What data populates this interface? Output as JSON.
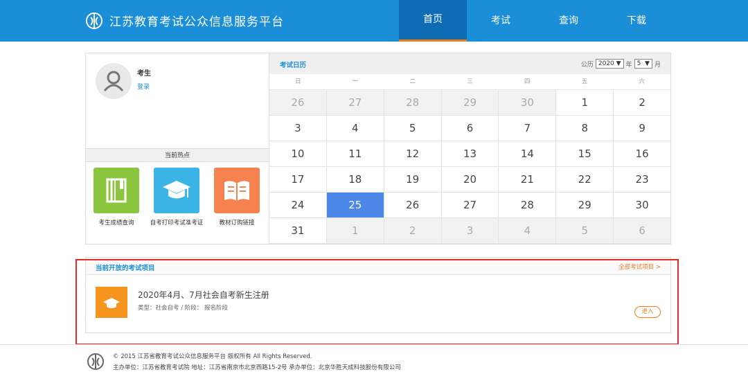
{
  "header": {
    "site_title": "江苏教育考试公众信息服务平台",
    "nav": [
      "首页",
      "考试",
      "查询",
      "下载"
    ],
    "active_nav": "首页"
  },
  "user": {
    "name": "考生",
    "login_label": "登录"
  },
  "hot": {
    "title": "当前热点",
    "items": [
      {
        "label": "考生成绩查询",
        "icon": "notebook-icon",
        "color": "#8cc63f"
      },
      {
        "label": "自考打印考试准考证",
        "icon": "graduation-cap-icon",
        "color": "#3bb4e6"
      },
      {
        "label": "教材订购链接",
        "icon": "open-book-icon",
        "color": "#f5824f"
      }
    ]
  },
  "calendar": {
    "title": "考试日历",
    "era_label": "公历",
    "year": "2020",
    "year_unit": "年",
    "month": "5",
    "month_unit": "月",
    "weekdays": [
      "日",
      "一",
      "二",
      "三",
      "四",
      "五",
      "六"
    ],
    "weeks": [
      [
        "26",
        "27",
        "28",
        "29",
        "30",
        "1",
        "2"
      ],
      [
        "3",
        "4",
        "5",
        "6",
        "7",
        "8",
        "9"
      ],
      [
        "10",
        "11",
        "12",
        "13",
        "14",
        "15",
        "16"
      ],
      [
        "17",
        "18",
        "19",
        "20",
        "21",
        "22",
        "23"
      ],
      [
        "24",
        "25",
        "26",
        "27",
        "28",
        "29",
        "30"
      ],
      [
        "31",
        "1",
        "2",
        "3",
        "4",
        "5",
        "6"
      ]
    ],
    "today": "25",
    "accent_color": "#4d87e8"
  },
  "projects": {
    "title": "当前开放的考试项目",
    "all_link": "全部考试项目 >",
    "item": {
      "name": "2020年4月、7月社会自考新生注册",
      "meta": "类型：社会自考 / 阶段： 报名阶段",
      "enter_label": "进入"
    }
  },
  "footer": {
    "line1": "© 2015 江苏省教育考试公众信息服务平台 版权所有 All Rights Reserved.",
    "line2": "主办单位：江苏省教育考试院 地址：江苏省南京市北京西路15-2号 承办单位：北京华胜天成科技股份有限公司"
  },
  "colors": {
    "header_bg": "#1a8fd8",
    "nav_active_bg": "#0d6cb4",
    "accent_orange": "#f07c1e",
    "highlight_outline": "#e8272d"
  }
}
